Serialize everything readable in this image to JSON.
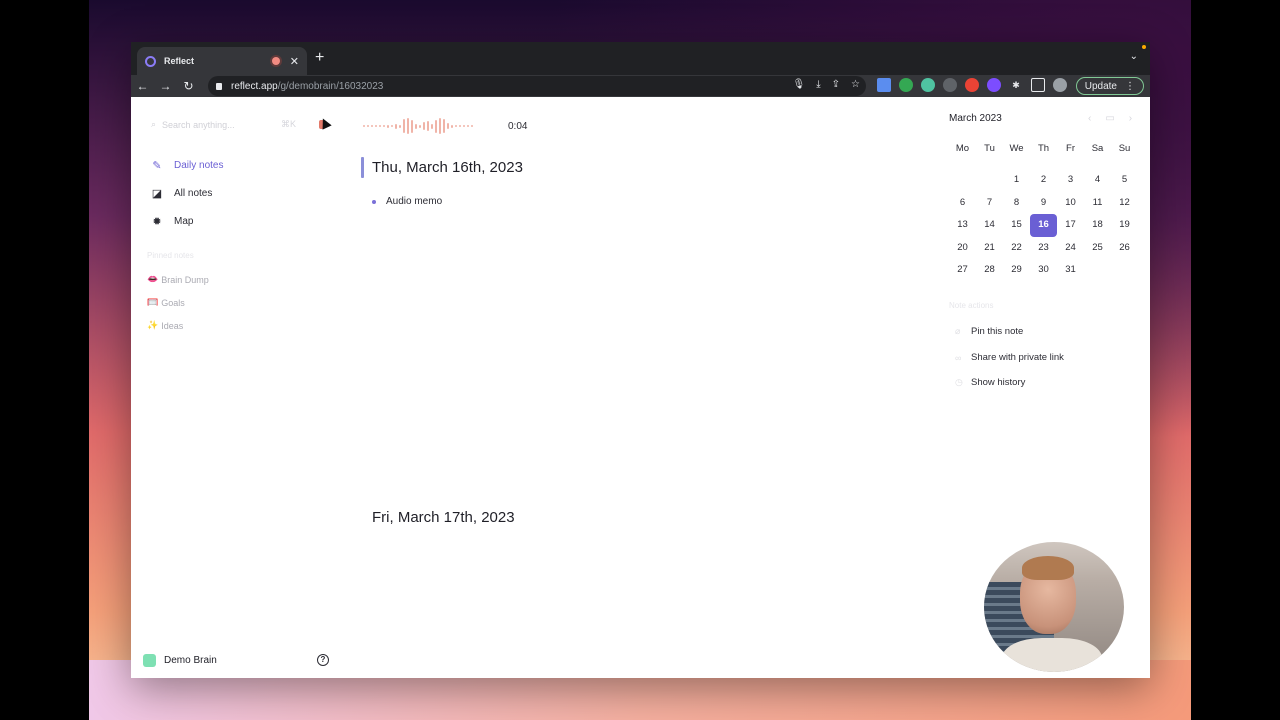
{
  "browser": {
    "tab_title": "Reflect",
    "url_host": "reflect.app",
    "url_path": "/g/demobrain/16032023",
    "update_label": "Update"
  },
  "sidebar": {
    "search_placeholder": "Search anything...",
    "search_shortcut": "⌘K",
    "nav": [
      {
        "label": "Daily notes",
        "icon": "pencil-icon",
        "active": true
      },
      {
        "label": "All notes",
        "icon": "notes-icon",
        "active": false
      },
      {
        "label": "Map",
        "icon": "map-icon",
        "active": false
      }
    ],
    "pinned_heading": "Pinned notes",
    "pinned": [
      {
        "emoji": "👄",
        "label": "Brain Dump"
      },
      {
        "emoji": "🥅",
        "label": "Goals"
      },
      {
        "emoji": "✨",
        "label": "Ideas"
      }
    ],
    "brain_name": "Demo Brain",
    "help_label": "?"
  },
  "recorder": {
    "time": "0:04",
    "levels": [
      0.1,
      0.1,
      0.1,
      0.1,
      0.1,
      0.1,
      0.2,
      0.1,
      0.3,
      0.2,
      0.9,
      1.0,
      0.8,
      0.3,
      0.2,
      0.5,
      0.6,
      0.3,
      0.8,
      1.0,
      0.9,
      0.4,
      0.2,
      0.1,
      0.1,
      0.1,
      0.1,
      0.1
    ]
  },
  "notes": {
    "day1_title": "Thu, March 16th, 2023",
    "day1_bullet": "Audio memo",
    "day2_title": "Fri, March 17th, 2023"
  },
  "calendar": {
    "title": "March 2023",
    "weekdays": [
      "Mo",
      "Tu",
      "We",
      "Th",
      "Fr",
      "Sa",
      "Su"
    ],
    "leading_blanks": 2,
    "days": 31,
    "selected": 16
  },
  "note_actions": {
    "heading": "Note actions",
    "items": [
      {
        "label": "Pin this note",
        "icon": "pin-icon"
      },
      {
        "label": "Share with private link",
        "icon": "link-icon"
      },
      {
        "label": "Show history",
        "icon": "history-icon"
      }
    ]
  },
  "colors": {
    "accent": "#6a5fd4",
    "brain": "#7ee0b3"
  }
}
